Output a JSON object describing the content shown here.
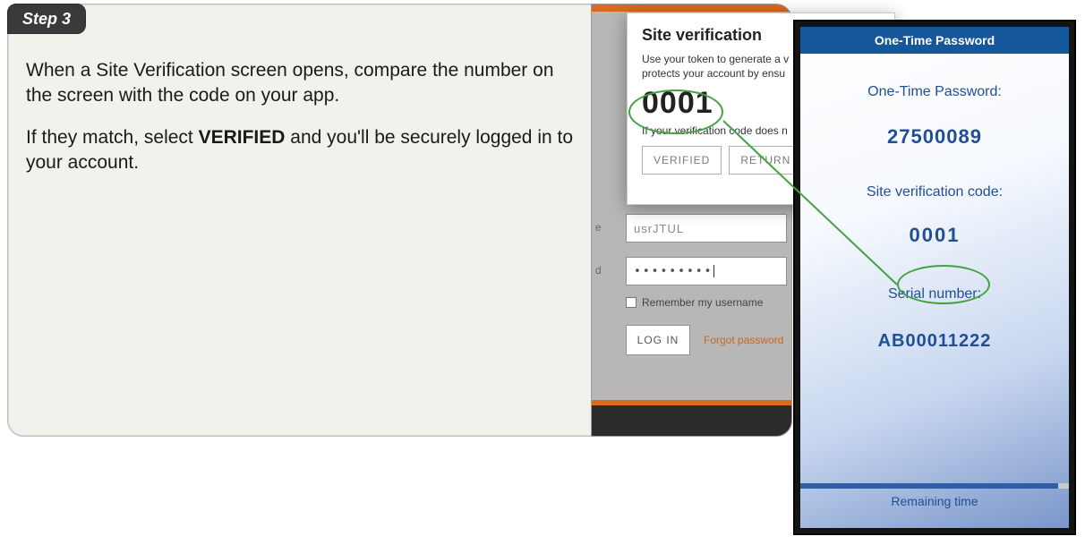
{
  "step": {
    "badge": "Step 3",
    "para1_a": "When a Site Verification screen opens, compare the number on the screen with the code on your app.",
    "para2_a": "If they match, select ",
    "para2_b": "VERIFIED",
    "para2_c": " and you'll be securely logged in to your account."
  },
  "login": {
    "label_a": "e",
    "label_b": "d",
    "username_partial": "usrJTUL",
    "password_dots": "•••••••••",
    "remember": "Remember my username",
    "login_btn": "LOG IN",
    "forgot": "Forgot password"
  },
  "popup": {
    "title": "Site verification",
    "desc_line1": "Use your token to generate a v",
    "desc_line2": "protects your account by ensu",
    "code": "0001",
    "note": "If your verification code does n",
    "btn_verified": "VERIFIED",
    "btn_return": "RETURN TO"
  },
  "phone": {
    "header": "One-Time Password",
    "otp_label": "One-Time Password:",
    "otp_value": "27500089",
    "site_label": "Site verification code:",
    "site_value": "0001",
    "serial_label": "Serial number:",
    "serial_value": "AB00011222",
    "footer": "Remaining time"
  }
}
